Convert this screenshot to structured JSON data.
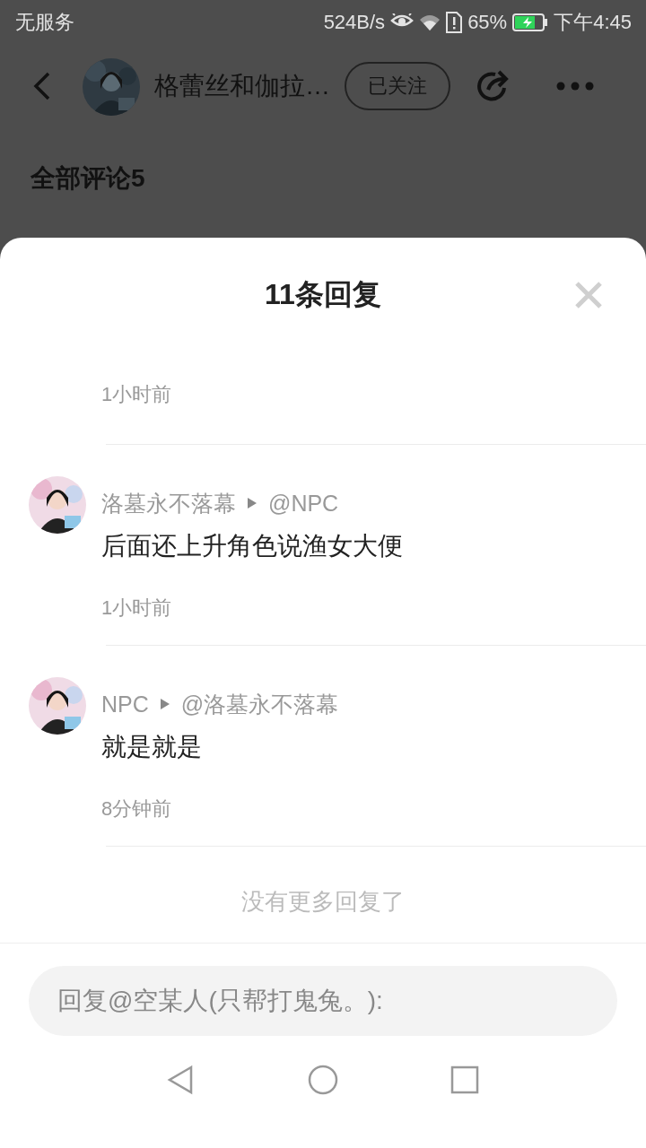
{
  "status_bar": {
    "carrier": "无服务",
    "speed": "524B/s",
    "battery": "65%",
    "time": "下午4:45"
  },
  "header": {
    "title": "格蕾丝和伽拉…",
    "follow_button": "已关注"
  },
  "comments_heading": "全部评论5",
  "sheet": {
    "title": "11条回复",
    "replies": [
      {
        "kind": "partial",
        "time": "1小时前"
      },
      {
        "kind": "full",
        "author": "洛墓永不落幕",
        "reply_to": "@NPC",
        "text": "后面还上升角色说渔女大便",
        "time": "1小时前"
      },
      {
        "kind": "full",
        "author": "NPC",
        "reply_to": "@洛墓永不落幕",
        "text": "就是就是",
        "time": "8分钟前"
      }
    ],
    "end_note": "没有更多回复了",
    "reply_field": {
      "placeholder": "回复@空某人(只帮打鬼兔。):"
    }
  }
}
